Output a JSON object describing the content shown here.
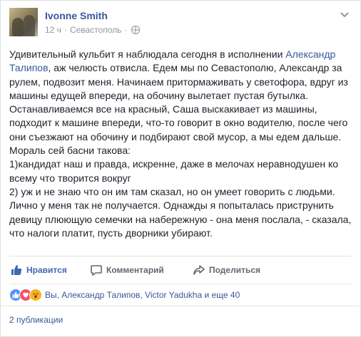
{
  "post": {
    "author": "Ivonne Smith",
    "time": "12 ч",
    "separator": "·",
    "location": "Севастополь",
    "dot": "·",
    "menu_icon": "chevron-down-icon",
    "privacy_icon": "globe-icon",
    "body": {
      "p1_a": "Удивительный кульбит я наблюдала сегодня в исполнении ",
      "p1_link": "Александр Талипов",
      "p1_b": ", аж челюсть отвисла. Едем мы по Севастополю, Александр за рулем, подвозит меня. Начинаем притормаживать у светофора, вдруг из машины едущей впереди, на обочину вылетает пустая бутылка. Останавливаемся все на красный, Саша выскакивает из машины, подходит к машине впереди, что-то говорит в окно водителю, после чего они съезжают на обочину и подбирают свой мусор, а мы едем дальше.",
      "p2": "Мораль сей басни такова:",
      "p3": "1)кандидат наш и правда, искренне, даже в мелочах неравнодушен ко всему что творится вокруг",
      "p4": "2) уж и не знаю что он им там сказал, но он умеет говорить с людьми. Лично у меня так не получается. Однажды я попыталась приструнить девицу плюющую семечки на набережную - она меня послала, - сказала, что налоги платит, пусть дворники убирают."
    }
  },
  "actions": {
    "like_label": "Нравится",
    "comment_label": "Комментарий",
    "share_label": "Поделиться"
  },
  "reactions": {
    "types": [
      "like",
      "love",
      "wow"
    ],
    "text": "Вы, Александр Талипов, Victor Yadukha и еще 40"
  },
  "shares": "2 публикации",
  "colors": {
    "link": "#365899",
    "like_active": "#4267b2",
    "muted": "#90949c"
  }
}
